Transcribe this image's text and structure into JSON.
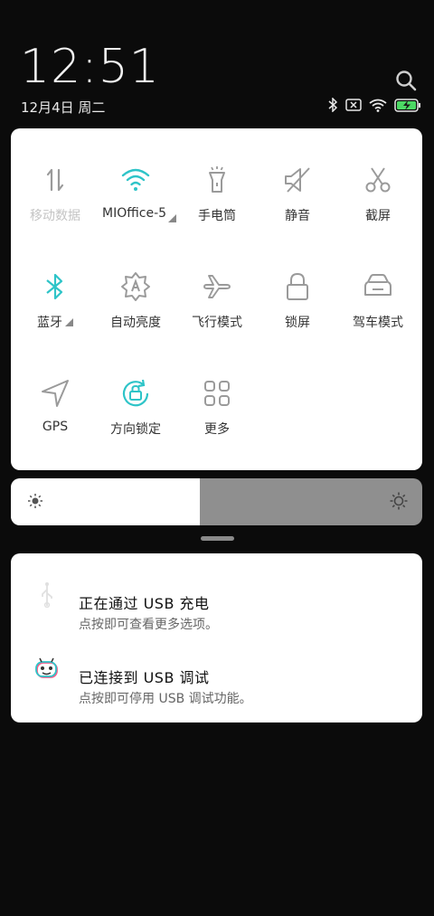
{
  "status": {
    "time": "12:51",
    "date": "12月4日 周二"
  },
  "icons": {
    "search": "search-icon",
    "bluetooth": "bluetooth-status-icon",
    "sim": "no-sim-icon",
    "wifi": "wifi-status-icon",
    "battery": "battery-charging-icon"
  },
  "tiles": [
    {
      "label": "移动数据",
      "icon": "mobile-data-icon",
      "active": false,
      "disabled": true
    },
    {
      "label": "MIOffice-5",
      "icon": "wifi-icon",
      "active": true,
      "disabled": false
    },
    {
      "label": "手电筒",
      "icon": "flashlight-icon",
      "active": false,
      "disabled": false
    },
    {
      "label": "静音",
      "icon": "mute-icon",
      "active": false,
      "disabled": false
    },
    {
      "label": "截屏",
      "icon": "screenshot-icon",
      "active": false,
      "disabled": false
    },
    {
      "label": "蓝牙",
      "icon": "bluetooth-icon",
      "active": true,
      "disabled": false
    },
    {
      "label": "自动亮度",
      "icon": "auto-brightness-icon",
      "active": false,
      "disabled": false
    },
    {
      "label": "飞行模式",
      "icon": "airplane-icon",
      "active": false,
      "disabled": false
    },
    {
      "label": "锁屏",
      "icon": "lock-icon",
      "active": false,
      "disabled": false
    },
    {
      "label": "驾车模式",
      "icon": "car-icon",
      "active": false,
      "disabled": false
    },
    {
      "label": "GPS",
      "icon": "gps-icon",
      "active": false,
      "disabled": false
    },
    {
      "label": "方向锁定",
      "icon": "rotation-lock-icon",
      "active": true,
      "disabled": false
    },
    {
      "label": "更多",
      "icon": "more-grid-icon",
      "active": false,
      "disabled": false
    }
  ],
  "brightness": {
    "level": 0.46
  },
  "notifications": [
    {
      "title": "正在通过 USB 充电",
      "body": "点按即可查看更多选项。",
      "icon": "usb-charging-icon"
    },
    {
      "title": "已连接到 USB 调试",
      "body": "点按即可停用 USB 调试功能。",
      "icon": "android-debug-icon"
    }
  ],
  "colors": {
    "accent": "#2ec4c8",
    "icon_gray": "#9a9a9a",
    "background": "#0b0b0b"
  }
}
